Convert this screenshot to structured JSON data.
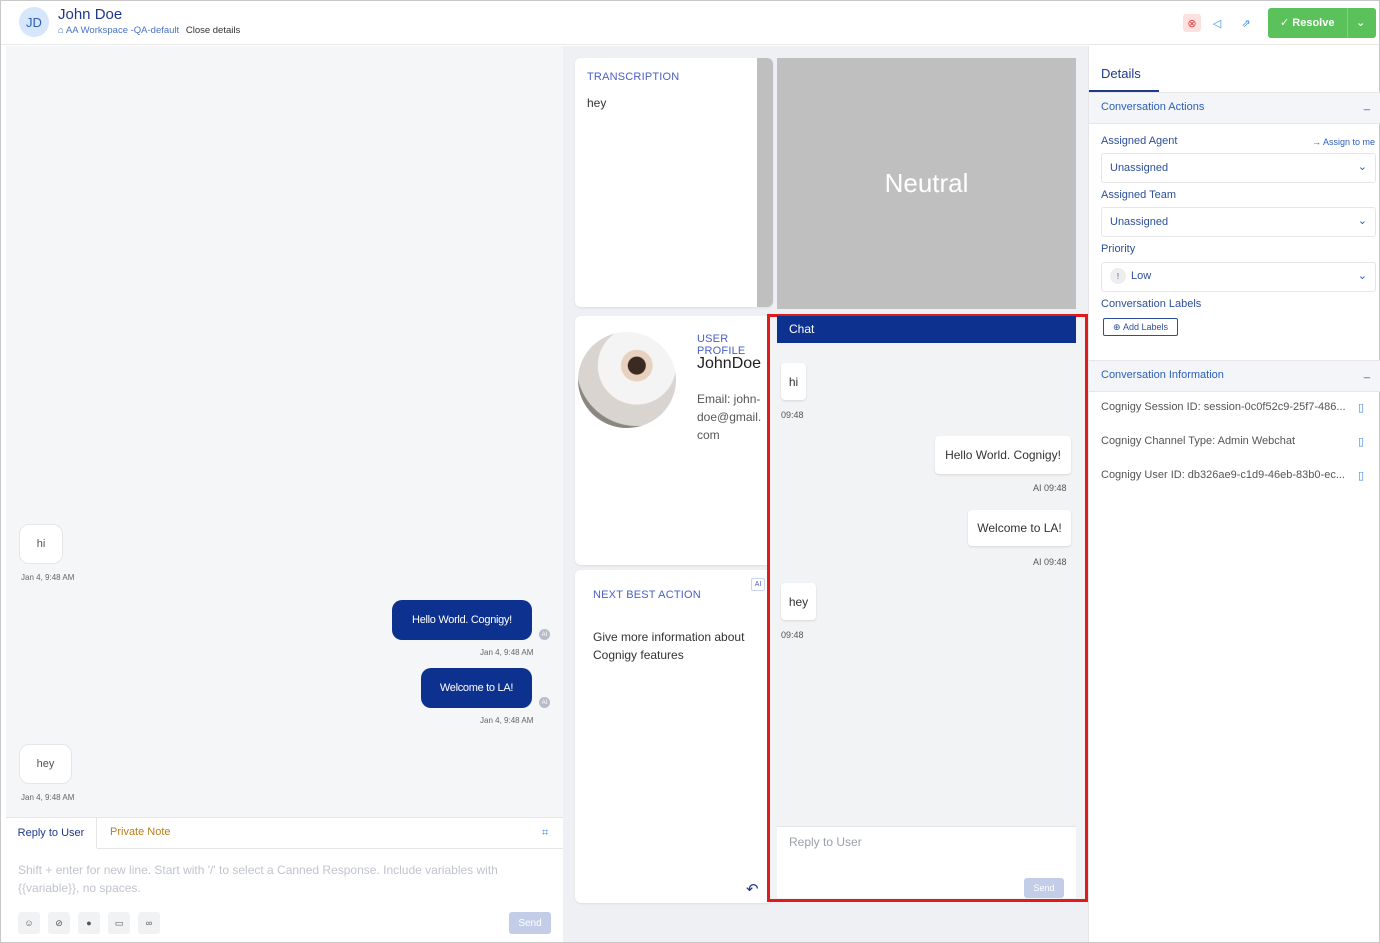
{
  "header": {
    "avatar_initials": "JD",
    "user_name": "John Doe",
    "workspace": "⌂ AA Workspace -QA-default",
    "close_details": "Close details",
    "resolve_label": "✓  Resolve",
    "icons": [
      "record-icon",
      "mute-icon",
      "share-icon"
    ]
  },
  "left_chat": {
    "messages": [
      {
        "text": "hi",
        "time": "Jan 4, 9:48 AM",
        "direction": "in"
      },
      {
        "text": "Hello World. Cognigy!",
        "time": "Jan 4, 9:48 AM",
        "direction": "out",
        "badge": "AI"
      },
      {
        "text": "Welcome to LA!",
        "time": "Jan 4, 9:48 AM",
        "direction": "out",
        "badge": "AI"
      },
      {
        "text": "hey",
        "time": "Jan 4, 9:48 AM",
        "direction": "in"
      }
    ],
    "reply_tab": "Reply to User",
    "note_tab": "Private Note",
    "placeholder": "Shift + enter for new line. Start with '/' to select a Canned Response. Include variables with {{variable}}, no spaces.",
    "send_label": "Send"
  },
  "transcription": {
    "title": "TRANSCRIPTION",
    "text": "hey"
  },
  "sentiment": {
    "label": "Neutral"
  },
  "user_profile": {
    "title": "USER PROFILE",
    "name": "JohnDoe",
    "email": "Email: john-doe@gmail.com"
  },
  "next_best_action": {
    "title": "NEXT BEST ACTION",
    "badge": "AI",
    "text": "Give more information about Cognigy features"
  },
  "chat_widget": {
    "title": "Chat",
    "messages": [
      {
        "text": "hi",
        "time": "09:48",
        "direction": "in"
      },
      {
        "text": "Hello World. Cognigy!",
        "time": "09:48",
        "direction": "out",
        "badge": "AI"
      },
      {
        "text": "Welcome to LA!",
        "time": "09:48",
        "direction": "out",
        "badge": "AI"
      },
      {
        "text": "hey",
        "time": "09:48",
        "direction": "in"
      }
    ],
    "placeholder": "Reply to User",
    "send_label": "Send"
  },
  "details": {
    "tab": "Details",
    "actions_title": "Conversation Actions",
    "assigned_agent_label": "Assigned Agent",
    "assign_to_me": "Assign to me",
    "assigned_agent_value": "Unassigned",
    "assigned_team_label": "Assigned Team",
    "assigned_team_value": "Unassigned",
    "priority_label": "Priority",
    "priority_value": "Low",
    "labels_label": "Conversation Labels",
    "add_labels": "Add Labels",
    "info_title": "Conversation Information",
    "info_rows": [
      "Cognigy Session ID: session-0c0f52c9-25f7-486...",
      "Cognigy Channel Type: Admin Webchat",
      "Cognigy User ID: db326ae9-c1d9-46eb-83b0-ec..."
    ]
  }
}
